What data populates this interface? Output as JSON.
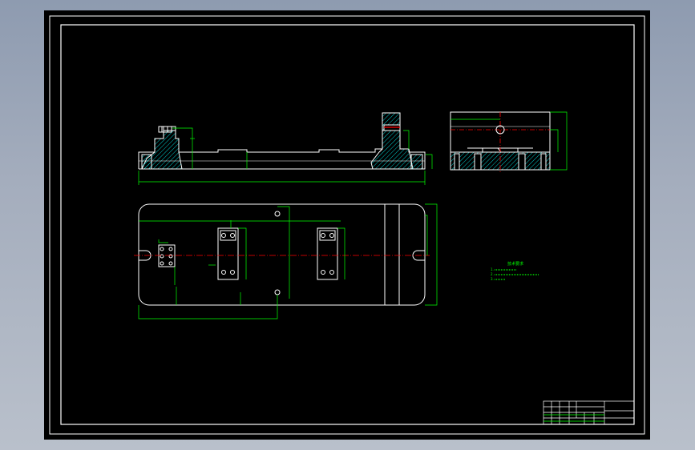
{
  "app": {
    "background_color": "#9aa5b6",
    "model_space_color": "#000000"
  },
  "drawing": {
    "line_color": "#ffffff",
    "dimension_color": "#00ff00",
    "centerline_color": "#ff0000",
    "hatch_color": "#00ffff",
    "notes_color": "#00ff00",
    "technical_requirements": {
      "heading": "技术要求",
      "lines": [
        "1.",
        "2.",
        "3."
      ]
    },
    "title_block_text": ""
  }
}
